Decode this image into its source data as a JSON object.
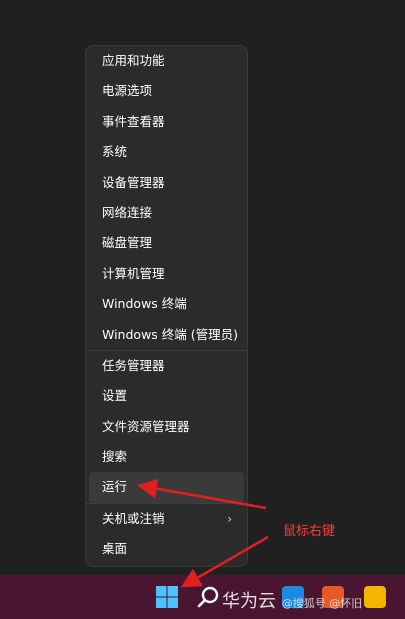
{
  "context_menu": {
    "items": [
      {
        "label": "应用和功能"
      },
      {
        "label": "电源选项"
      },
      {
        "label": "事件查看器"
      },
      {
        "label": "系统"
      },
      {
        "label": "设备管理器"
      },
      {
        "label": "网络连接"
      },
      {
        "label": "磁盘管理"
      },
      {
        "label": "计算机管理"
      },
      {
        "label": "Windows 终端"
      },
      {
        "label": "Windows 终端 (管理员)"
      },
      {
        "label": "任务管理器"
      },
      {
        "label": "设置"
      },
      {
        "label": "文件资源管理器"
      },
      {
        "label": "搜索"
      },
      {
        "label": "运行",
        "highlighted": true
      },
      {
        "label": "关机或注销",
        "submenu": true
      },
      {
        "label": "桌面"
      }
    ],
    "submenu_chevron": "›"
  },
  "annotation": {
    "text": "鼠标右键",
    "color": "#ff3b3b"
  },
  "taskbar": {
    "color": "#4a1530",
    "icons": [
      "windows-start-icon",
      "search-icon",
      "widgets-icon",
      "browser-icon",
      "office-icon",
      "file-explorer-icon"
    ]
  },
  "watermark": {
    "text": "华为云",
    "sub_text": "@搜狐号 @怀旧"
  }
}
